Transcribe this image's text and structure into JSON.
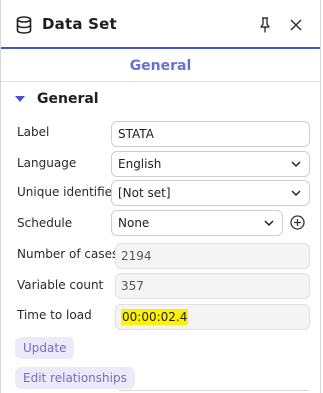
{
  "panel": {
    "title": "Data Set",
    "icons": {
      "title": "database-icon",
      "pin": "pin-icon",
      "close": "close-icon"
    }
  },
  "tabs": [
    {
      "label": "General",
      "active": true
    }
  ],
  "section": {
    "title": "General",
    "expanded": true
  },
  "fields": {
    "label": {
      "label": "Label",
      "value": "STATA"
    },
    "language": {
      "label": "Language",
      "value": "English"
    },
    "unique_identifier": {
      "label": "Unique identifier",
      "value": "[Not set]"
    },
    "schedule": {
      "label": "Schedule",
      "value": "None"
    },
    "number_of_cases": {
      "label": "Number of cases",
      "value": "2194"
    },
    "variable_count": {
      "label": "Variable count",
      "value": "357"
    },
    "time_to_load": {
      "label": "Time to load",
      "value": "00:00:02.4"
    }
  },
  "buttons": {
    "update": "Update",
    "edit_relationships": "Edit relationships"
  },
  "colors": {
    "accent": "#4b51d6",
    "tab_text": "#6b6fd1",
    "highlight": "#fff200",
    "button_bg": "#eceaf8"
  }
}
